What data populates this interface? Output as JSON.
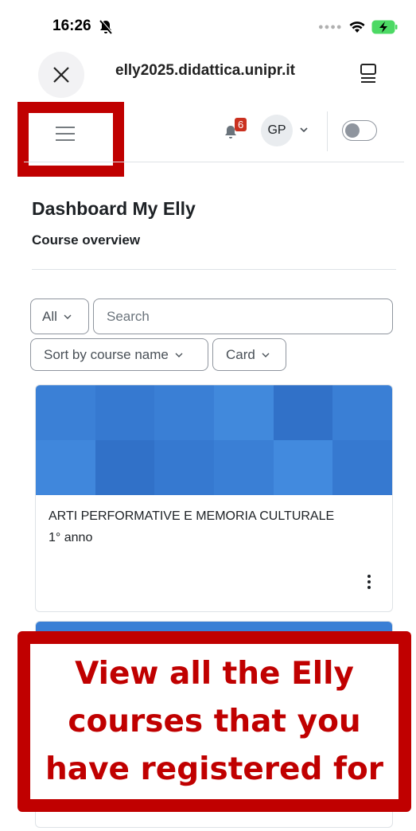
{
  "status_bar": {
    "time": "16:26"
  },
  "browser": {
    "url": "elly2025.didattica.unipr.it"
  },
  "navbar": {
    "notification_count": "6",
    "avatar_initials": "GP"
  },
  "page": {
    "title": "Dashboard My Elly",
    "section": "Course overview"
  },
  "filters": {
    "grouping": "All",
    "search_placeholder": "Search",
    "sort": "Sort by course name",
    "view": "Card"
  },
  "courses": [
    {
      "name": "ARTI PERFORMATIVE E MEMORIA CULTURALE",
      "meta": "1° anno"
    }
  ],
  "callout": {
    "text": "View all the Elly courses that you have registered for"
  },
  "colors": {
    "accent": "#c00000",
    "course_image": "#3a7fd5"
  }
}
